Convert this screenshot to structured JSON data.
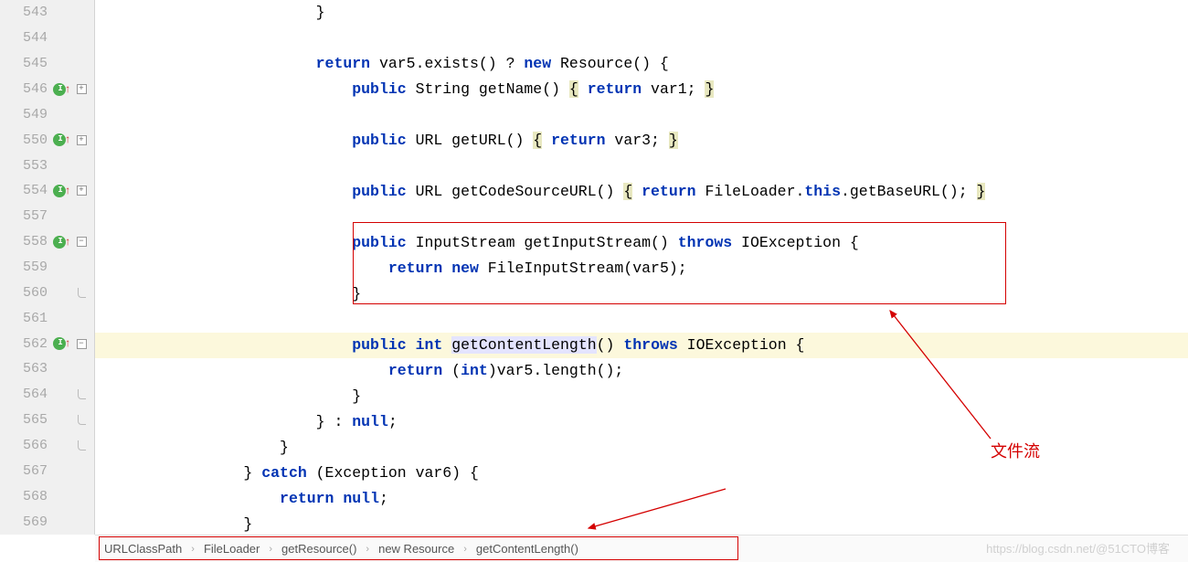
{
  "gutter": [
    {
      "num": "543",
      "icon": "",
      "fold": ""
    },
    {
      "num": "544",
      "icon": "",
      "fold": ""
    },
    {
      "num": "545",
      "icon": "",
      "fold": ""
    },
    {
      "num": "546",
      "icon": "override",
      "fold": "plus"
    },
    {
      "num": "549",
      "icon": "",
      "fold": ""
    },
    {
      "num": "550",
      "icon": "override",
      "fold": "plus"
    },
    {
      "num": "553",
      "icon": "",
      "fold": ""
    },
    {
      "num": "554",
      "icon": "override",
      "fold": "plus"
    },
    {
      "num": "557",
      "icon": "",
      "fold": ""
    },
    {
      "num": "558",
      "icon": "override",
      "fold": "minus"
    },
    {
      "num": "559",
      "icon": "",
      "fold": ""
    },
    {
      "num": "560",
      "icon": "",
      "fold": "handle"
    },
    {
      "num": "561",
      "icon": "",
      "fold": ""
    },
    {
      "num": "562",
      "icon": "override",
      "fold": "minus"
    },
    {
      "num": "563",
      "icon": "",
      "fold": ""
    },
    {
      "num": "564",
      "icon": "",
      "fold": "handle"
    },
    {
      "num": "565",
      "icon": "",
      "fold": "handle"
    },
    {
      "num": "566",
      "icon": "",
      "fold": "handle"
    },
    {
      "num": "567",
      "icon": "",
      "fold": ""
    },
    {
      "num": "568",
      "icon": "",
      "fold": ""
    },
    {
      "num": "569",
      "icon": "",
      "fold": ""
    }
  ],
  "code": {
    "l543": "                        }",
    "l545_return": "return",
    "l545_mid": " var5.exists() ? ",
    "l545_new": "new",
    "l545_end": " Resource() {",
    "l546_pub": "public",
    "l546_sig": " String getName() ",
    "l546_ret": "return",
    "l546_end": " var1; ",
    "l550_pub": "public",
    "l550_sig": " URL getURL() ",
    "l550_ret": "return",
    "l550_end": " var3; ",
    "l554_pub": "public",
    "l554_sig": " URL getCodeSourceURL() ",
    "l554_ret": "return",
    "l554_mid": " FileLoader.",
    "l554_this": "this",
    "l554_end": ".getBaseURL(); ",
    "l558_pub": "public",
    "l558_sig": " InputStream getInputStream() ",
    "l558_throws": "throws",
    "l558_exc": " IOException {",
    "l559_ret": "return",
    "l559_new": "new",
    "l559_end": " FileInputStream(var5);",
    "l560": "                            }",
    "l562_pub": "public",
    "l562_int": "int",
    "l562_name": "getContentLength",
    "l562_paren": "() ",
    "l562_throws": "throws",
    "l562_exc": " IOException {",
    "l563_ret": "return",
    "l563_int": "int",
    "l563_end": ")var5.length();",
    "l564": "                            }",
    "l565_a": "                        } : ",
    "l565_null": "null",
    "l565_b": ";",
    "l566": "                    }",
    "l567_a": "                } ",
    "l567_catch": "catch",
    "l567_b": " (Exception var6) {",
    "l568_ret": "return",
    "l568_null": "null",
    "l568_b": ";",
    "l569": "                }"
  },
  "breadcrumb": [
    "URLClassPath",
    "FileLoader",
    "getResource()",
    "new Resource",
    "getContentLength()"
  ],
  "annotation": "文件流",
  "watermark": "https://blog.csdn.net/@51CTO博客"
}
